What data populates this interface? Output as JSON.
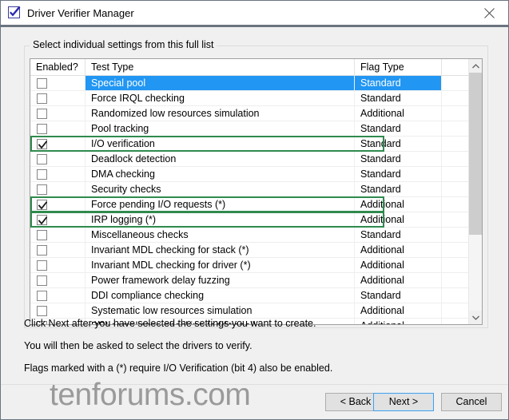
{
  "window": {
    "title": "Driver Verifier Manager",
    "icon": "driver-verifier-checkmark-icon",
    "close_label": "close-icon"
  },
  "groupbox": {
    "legend": "Select individual settings from this full list"
  },
  "list": {
    "columns": [
      "Enabled?",
      "Test Type",
      "Flag Type",
      ""
    ],
    "rows": [
      {
        "enabled": false,
        "name": "Special pool",
        "flag": "Standard",
        "selected": true,
        "highlighted": false
      },
      {
        "enabled": false,
        "name": "Force IRQL checking",
        "flag": "Standard",
        "selected": false,
        "highlighted": false
      },
      {
        "enabled": false,
        "name": "Randomized low resources simulation",
        "flag": "Additional",
        "selected": false,
        "highlighted": false
      },
      {
        "enabled": false,
        "name": "Pool tracking",
        "flag": "Standard",
        "selected": false,
        "highlighted": false
      },
      {
        "enabled": true,
        "name": "I/O verification",
        "flag": "Standard",
        "selected": false,
        "highlighted": true
      },
      {
        "enabled": false,
        "name": "Deadlock detection",
        "flag": "Standard",
        "selected": false,
        "highlighted": false
      },
      {
        "enabled": false,
        "name": "DMA checking",
        "flag": "Standard",
        "selected": false,
        "highlighted": false
      },
      {
        "enabled": false,
        "name": "Security checks",
        "flag": "Standard",
        "selected": false,
        "highlighted": false
      },
      {
        "enabled": true,
        "name": "Force pending I/O requests (*)",
        "flag": "Additional",
        "selected": false,
        "highlighted": true
      },
      {
        "enabled": true,
        "name": "IRP logging (*)",
        "flag": "Additional",
        "selected": false,
        "highlighted": true
      },
      {
        "enabled": false,
        "name": "Miscellaneous checks",
        "flag": "Standard",
        "selected": false,
        "highlighted": false
      },
      {
        "enabled": false,
        "name": "Invariant MDL checking for stack (*)",
        "flag": "Additional",
        "selected": false,
        "highlighted": false
      },
      {
        "enabled": false,
        "name": "Invariant MDL checking for driver (*)",
        "flag": "Additional",
        "selected": false,
        "highlighted": false
      },
      {
        "enabled": false,
        "name": "Power framework delay fuzzing",
        "flag": "Additional",
        "selected": false,
        "highlighted": false
      },
      {
        "enabled": false,
        "name": "DDI compliance checking",
        "flag": "Standard",
        "selected": false,
        "highlighted": false
      },
      {
        "enabled": false,
        "name": "Systematic low resources simulation",
        "flag": "Additional",
        "selected": false,
        "highlighted": false
      },
      {
        "enabled": false,
        "name": "DDI compliance checking (additional)",
        "flag": "Additional",
        "selected": false,
        "highlighted": false
      }
    ],
    "scrollbar": {
      "up_icon": "chevron-up-icon",
      "down_icon": "chevron-down-icon"
    }
  },
  "instructions": {
    "line1": "Click Next after you have selected the settings you want to create.",
    "line2": "You will then be asked to select the drivers to verify.",
    "line3": "Flags marked with a (*) require I/O Verification (bit 4) also be enabled."
  },
  "watermark": "tenforums.com",
  "footer": {
    "back": "< Back",
    "next": "Next >",
    "cancel": "Cancel"
  },
  "colors": {
    "selection_blue": "#2196f3",
    "annotation_green": "#2f8a4e",
    "titlebar_border": "#6a7480",
    "dialog_bg": "#f0f0f0",
    "focus_blue": "#4a9ee0"
  }
}
